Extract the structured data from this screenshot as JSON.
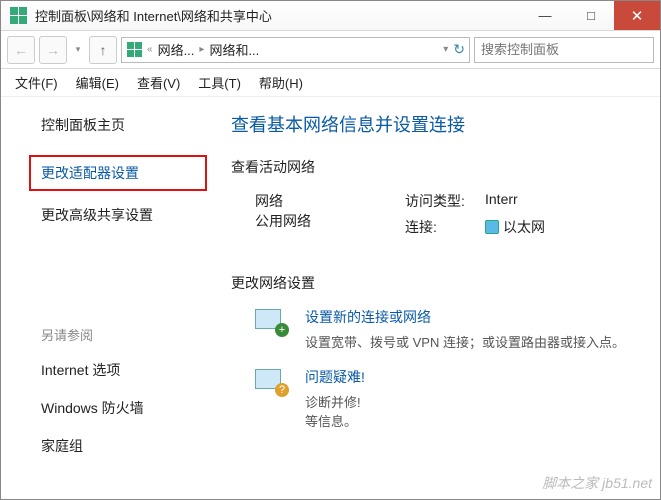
{
  "title": "控制面板\\网络和 Internet\\网络和共享中心",
  "winbtns": {
    "min": "—",
    "max": "□",
    "close": "✕"
  },
  "nav": {
    "crumb1": "网络...",
    "crumb2": "网络和...",
    "search_placeholder": "搜索控制面板"
  },
  "menu": {
    "file": "文件(F)",
    "edit": "编辑(E)",
    "view": "查看(V)",
    "tools": "工具(T)",
    "help": "帮助(H)"
  },
  "sidebar": {
    "home": "控制面板主页",
    "adapter": "更改适配器设置",
    "advshare": "更改高级共享设置",
    "also": "另请参阅",
    "inetopt": "Internet 选项",
    "firewall": "Windows 防火墙",
    "homegroup": "家庭组"
  },
  "main": {
    "heading": "查看基本网络信息并设置连接",
    "activenet_label": "查看活动网络",
    "net_name": "网络",
    "net_type": "公用网络",
    "access_label": "访问类型:",
    "access_value": "Interr",
    "conn_label": "连接:",
    "conn_value": "以太网",
    "changenet_label": "更改网络设置",
    "setup_title": "设置新的连接或网络",
    "setup_desc": "设置宽带、拨号或 VPN 连接；或设置路由器或接入点。",
    "trouble_title": "问题疑难!",
    "trouble_desc": "诊断并修!\n等信息。"
  },
  "watermark": "脚本之家 jb51.net"
}
